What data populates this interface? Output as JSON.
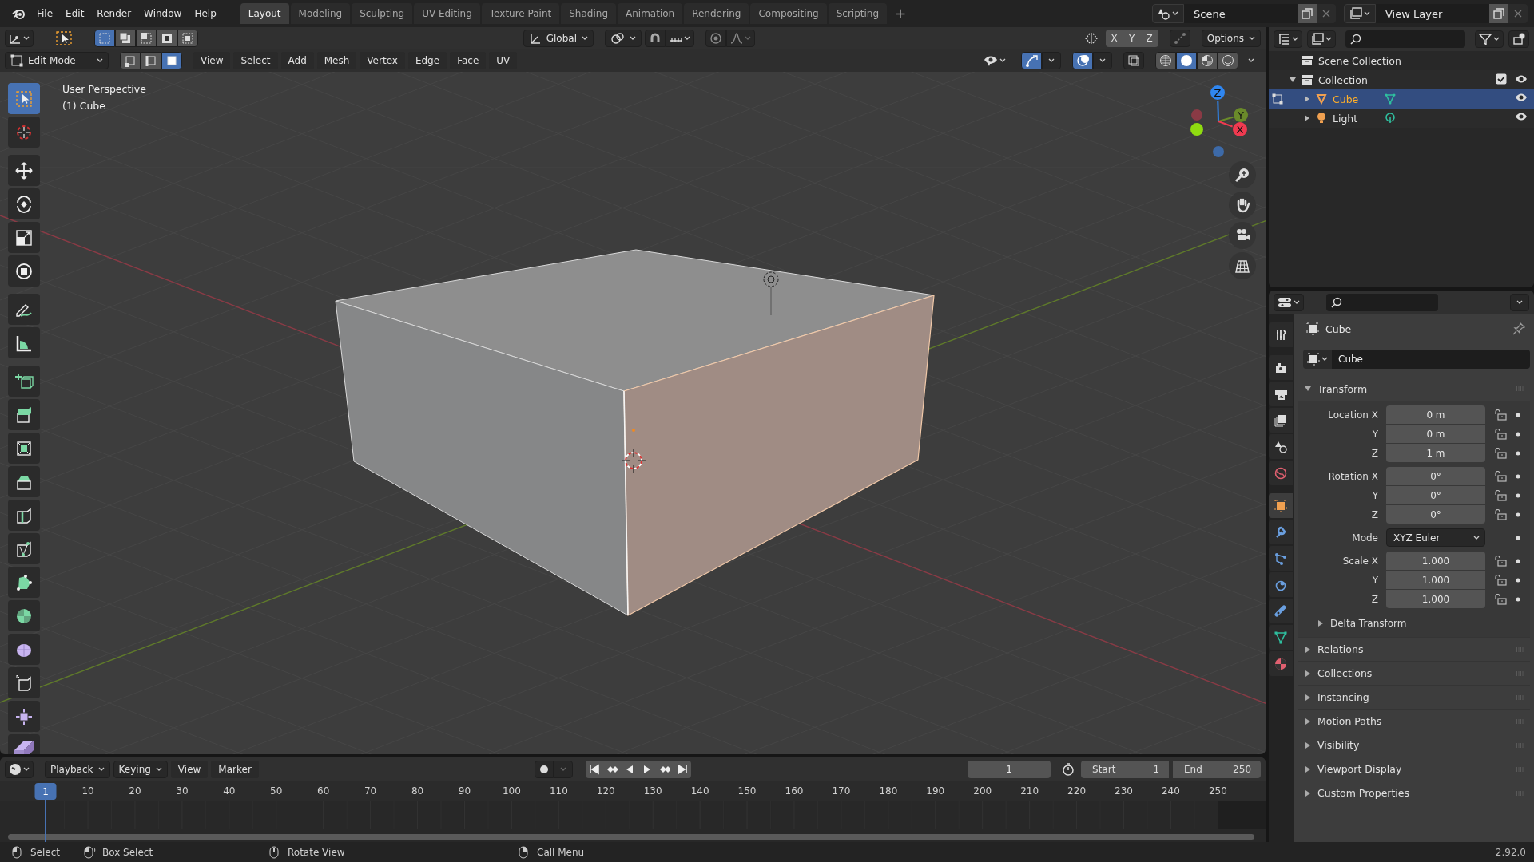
{
  "top_bar": {
    "menus": [
      "File",
      "Edit",
      "Render",
      "Window",
      "Help"
    ],
    "workspaces": [
      {
        "label": "Layout",
        "selected": true
      },
      {
        "label": "Modeling",
        "selected": false
      },
      {
        "label": "Sculpting",
        "selected": false
      },
      {
        "label": "UV Editing",
        "selected": false
      },
      {
        "label": "Texture Paint",
        "selected": false
      },
      {
        "label": "Shading",
        "selected": false
      },
      {
        "label": "Animation",
        "selected": false
      },
      {
        "label": "Rendering",
        "selected": false
      },
      {
        "label": "Compositing",
        "selected": false
      },
      {
        "label": "Scripting",
        "selected": false
      }
    ],
    "add_workspace": "+",
    "scene": "Scene",
    "view_layer": "View Layer"
  },
  "tool_header": {
    "selection_modes": [
      {
        "selected": true
      },
      {
        "selected": false
      },
      {
        "selected": false
      },
      {
        "selected": false
      },
      {
        "selected": false
      }
    ],
    "orientation": "Global",
    "mirror_axes": [
      "X",
      "Y",
      "Z"
    ],
    "options": "Options"
  },
  "viewport_header": {
    "mode": "Edit Mode",
    "select_elements": [
      {
        "kind": "vertex",
        "selected": false
      },
      {
        "kind": "edge",
        "selected": false
      },
      {
        "kind": "face",
        "selected": true
      }
    ],
    "menus": [
      "View",
      "Select",
      "Add",
      "Mesh",
      "Vertex",
      "Edge",
      "Face",
      "UV"
    ],
    "overlay_toggles": [
      {
        "kind": "gizmo",
        "on": true
      },
      {
        "kind": "overlays",
        "on": true
      }
    ],
    "shading": [
      {
        "kind": "wireframe",
        "selected": false
      },
      {
        "kind": "solid",
        "selected": true
      },
      {
        "kind": "material",
        "selected": false
      },
      {
        "kind": "rendered",
        "selected": false
      }
    ]
  },
  "viewport": {
    "view_name": "User Perspective",
    "object_label": "(1) Cube",
    "tools": [
      {
        "kind": "select",
        "selected": true
      },
      {
        "kind": "cursor",
        "selected": false
      },
      {
        "kind": "move",
        "selected": false
      },
      {
        "kind": "rotate",
        "selected": false
      },
      {
        "kind": "scale",
        "selected": false
      },
      {
        "kind": "transform",
        "selected": false
      },
      {
        "kind": "annotate",
        "selected": false
      },
      {
        "kind": "measure",
        "selected": false
      },
      {
        "kind": "add-cube",
        "selected": false
      },
      {
        "kind": "extrude",
        "selected": false
      },
      {
        "kind": "inset",
        "selected": false
      },
      {
        "kind": "bevel",
        "selected": false
      },
      {
        "kind": "loop-cut",
        "selected": false
      },
      {
        "kind": "knife",
        "selected": false
      },
      {
        "kind": "poly-build",
        "selected": false
      },
      {
        "kind": "spin",
        "selected": false
      },
      {
        "kind": "smooth",
        "selected": false
      },
      {
        "kind": "edge-slide",
        "selected": false
      },
      {
        "kind": "shrink",
        "selected": false
      },
      {
        "kind": "shear",
        "selected": false
      }
    ],
    "axes": [
      {
        "kind": "z",
        "label": "Z"
      },
      {
        "kind": "y",
        "label": "Y"
      },
      {
        "kind": "x",
        "label": "X"
      }
    ]
  },
  "outliner": {
    "tree": [
      {
        "label": "Scene Collection",
        "kind": "scene",
        "children": [
          {
            "label": "Collection",
            "kind": "collection",
            "expanded": true,
            "checked": true,
            "visible": true,
            "children": [
              {
                "label": "Cube",
                "kind": "mesh",
                "selected": true,
                "expanded": false,
                "visible": true
              },
              {
                "label": "Light",
                "kind": "light",
                "selected": false,
                "expanded": false,
                "visible": true
              }
            ]
          }
        ]
      }
    ]
  },
  "properties": {
    "tabs": [
      {
        "kind": "tool",
        "selected": false
      },
      {
        "kind": "render",
        "selected": false
      },
      {
        "kind": "output",
        "selected": false
      },
      {
        "kind": "view-layer",
        "selected": false
      },
      {
        "kind": "scene",
        "selected": false
      },
      {
        "kind": "world",
        "selected": false
      },
      {
        "kind": "object",
        "selected": true
      },
      {
        "kind": "modifiers",
        "selected": false
      },
      {
        "kind": "particles",
        "selected": false
      },
      {
        "kind": "physics",
        "selected": false
      },
      {
        "kind": "constraints",
        "selected": false
      },
      {
        "kind": "data",
        "selected": false
      },
      {
        "kind": "material",
        "selected": false
      }
    ],
    "context": "Cube",
    "name": "Cube",
    "transform": {
      "label": "Transform",
      "expanded": true,
      "groups": [
        {
          "rows": [
            {
              "kind": "number",
              "label": "Location X",
              "value": "0 m"
            },
            {
              "kind": "number",
              "label": "Y",
              "value": "0 m"
            },
            {
              "kind": "number",
              "label": "Z",
              "value": "1 m"
            }
          ]
        },
        {
          "rows": [
            {
              "kind": "number",
              "label": "Rotation X",
              "value": "0°"
            },
            {
              "kind": "number",
              "label": "Y",
              "value": "0°"
            },
            {
              "kind": "number",
              "label": "Z",
              "value": "0°"
            }
          ]
        },
        {
          "rows": [
            {
              "kind": "dropdown",
              "label": "Mode",
              "value": "XYZ Euler"
            }
          ]
        },
        {
          "rows": [
            {
              "kind": "number",
              "label": "Scale X",
              "value": "1.000"
            },
            {
              "kind": "number",
              "label": "Y",
              "value": "1.000"
            },
            {
              "kind": "number",
              "label": "Z",
              "value": "1.000"
            }
          ]
        }
      ],
      "subpanel": {
        "label": "Delta Transform",
        "expanded": false
      }
    },
    "panels": [
      {
        "label": "Relations",
        "expanded": false
      },
      {
        "label": "Collections",
        "expanded": false
      },
      {
        "label": "Instancing",
        "expanded": false
      },
      {
        "label": "Motion Paths",
        "expanded": false
      },
      {
        "label": "Visibility",
        "expanded": false
      },
      {
        "label": "Viewport Display",
        "expanded": false
      },
      {
        "label": "Custom Properties",
        "expanded": false
      }
    ]
  },
  "timeline": {
    "menus": [
      {
        "kind": "dropdown",
        "label": "Playback"
      },
      {
        "kind": "dropdown",
        "label": "Keying"
      },
      {
        "kind": "menu",
        "label": "View"
      },
      {
        "kind": "menu",
        "label": "Marker"
      }
    ],
    "current_frame": "1",
    "start_label": "Start",
    "start": "1",
    "end_label": "End",
    "end": "250",
    "playhead": "1",
    "ruler": [
      "10",
      "20",
      "30",
      "40",
      "50",
      "60",
      "70",
      "80",
      "90",
      "100",
      "110",
      "120",
      "130",
      "140",
      "150",
      "160",
      "170",
      "180",
      "190",
      "200",
      "210",
      "220",
      "230",
      "240",
      "250"
    ]
  },
  "status_bar": {
    "hints": [
      {
        "kind": "left-click",
        "label": "Select"
      },
      {
        "kind": "drag",
        "label": "Box Select"
      },
      {
        "kind": "middle-click",
        "label": "Rotate View"
      },
      {
        "kind": "right-click",
        "label": "Call Menu"
      }
    ],
    "version": "2.92.0"
  }
}
